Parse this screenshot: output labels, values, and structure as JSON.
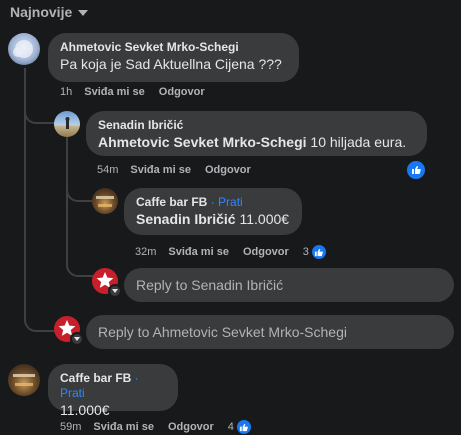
{
  "sort": {
    "label": "Najnovije"
  },
  "comments": [
    {
      "author": "Ahmetovic Sevket Mrko-Schegi",
      "text": "Pa koja je Sad Aktuellna Cijena ???",
      "time": "1h",
      "like_label": "Sviđa mi se",
      "reply_label": "Odgovor"
    },
    {
      "author": "Caffe bar FB",
      "follow_sep": " · ",
      "follow_label": "Prati",
      "text": "11.000€",
      "time": "59m",
      "like_label": "Sviđa mi se",
      "reply_label": "Odgovor",
      "reaction_count": "4"
    }
  ],
  "replies": [
    {
      "author": "Senadin Ibričić",
      "mention": "Ahmetovic Sevket Mrko-Schegi",
      "text": " 10 hiljada eura.",
      "time": "54m",
      "like_label": "Sviđa mi se",
      "reply_label": "Odgovor"
    },
    {
      "author": "Caffe bar FB",
      "follow_sep": " · ",
      "follow_label": "Prati",
      "mention": "Senadin Ibričić",
      "text": " 11.000€",
      "time": "32m",
      "like_label": "Sviđa mi se",
      "reply_label": "Odgovor",
      "reaction_count": "3"
    }
  ],
  "reply_inputs": {
    "nested_placeholder": "Reply to Senadin Ibričić",
    "top_placeholder": "Reply to Ahmetovic Sevket Mrko-Schegi"
  },
  "colors": {
    "background": "#18191a",
    "bubble": "#3a3b3c",
    "link": "#2d88ff",
    "like": "#1877f2"
  }
}
